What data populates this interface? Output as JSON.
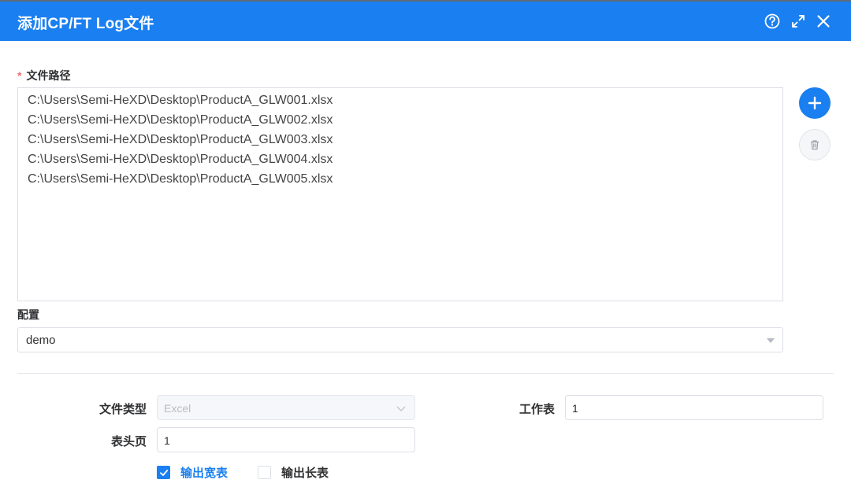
{
  "dialog": {
    "title": "添加CP/FT Log文件",
    "help_icon": "help-circle-icon",
    "maximize_icon": "expand-icon",
    "close_icon": "close-icon"
  },
  "file_path": {
    "required_mark": "*",
    "label": "文件路径",
    "paths": [
      "C:\\Users\\Semi-HeXD\\Desktop\\ProductA_GLW001.xlsx",
      "C:\\Users\\Semi-HeXD\\Desktop\\ProductA_GLW002.xlsx",
      "C:\\Users\\Semi-HeXD\\Desktop\\ProductA_GLW003.xlsx",
      "C:\\Users\\Semi-HeXD\\Desktop\\ProductA_GLW004.xlsx",
      "C:\\Users\\Semi-HeXD\\Desktop\\ProductA_GLW005.xlsx"
    ],
    "add_icon": "plus-icon",
    "delete_icon": "trash-icon"
  },
  "config": {
    "label": "配置",
    "selected": "demo"
  },
  "options": {
    "file_type_label": "文件类型",
    "file_type_value": "Excel",
    "sheet_label": "工作表",
    "sheet_value": "1",
    "header_page_label": "表头页",
    "header_page_value": "1",
    "wide_table_label": "输出宽表",
    "wide_table_checked": true,
    "long_table_label": "输出长表",
    "long_table_checked": false
  },
  "colors": {
    "primary": "#1a7ff0",
    "required": "#f56c6c"
  }
}
